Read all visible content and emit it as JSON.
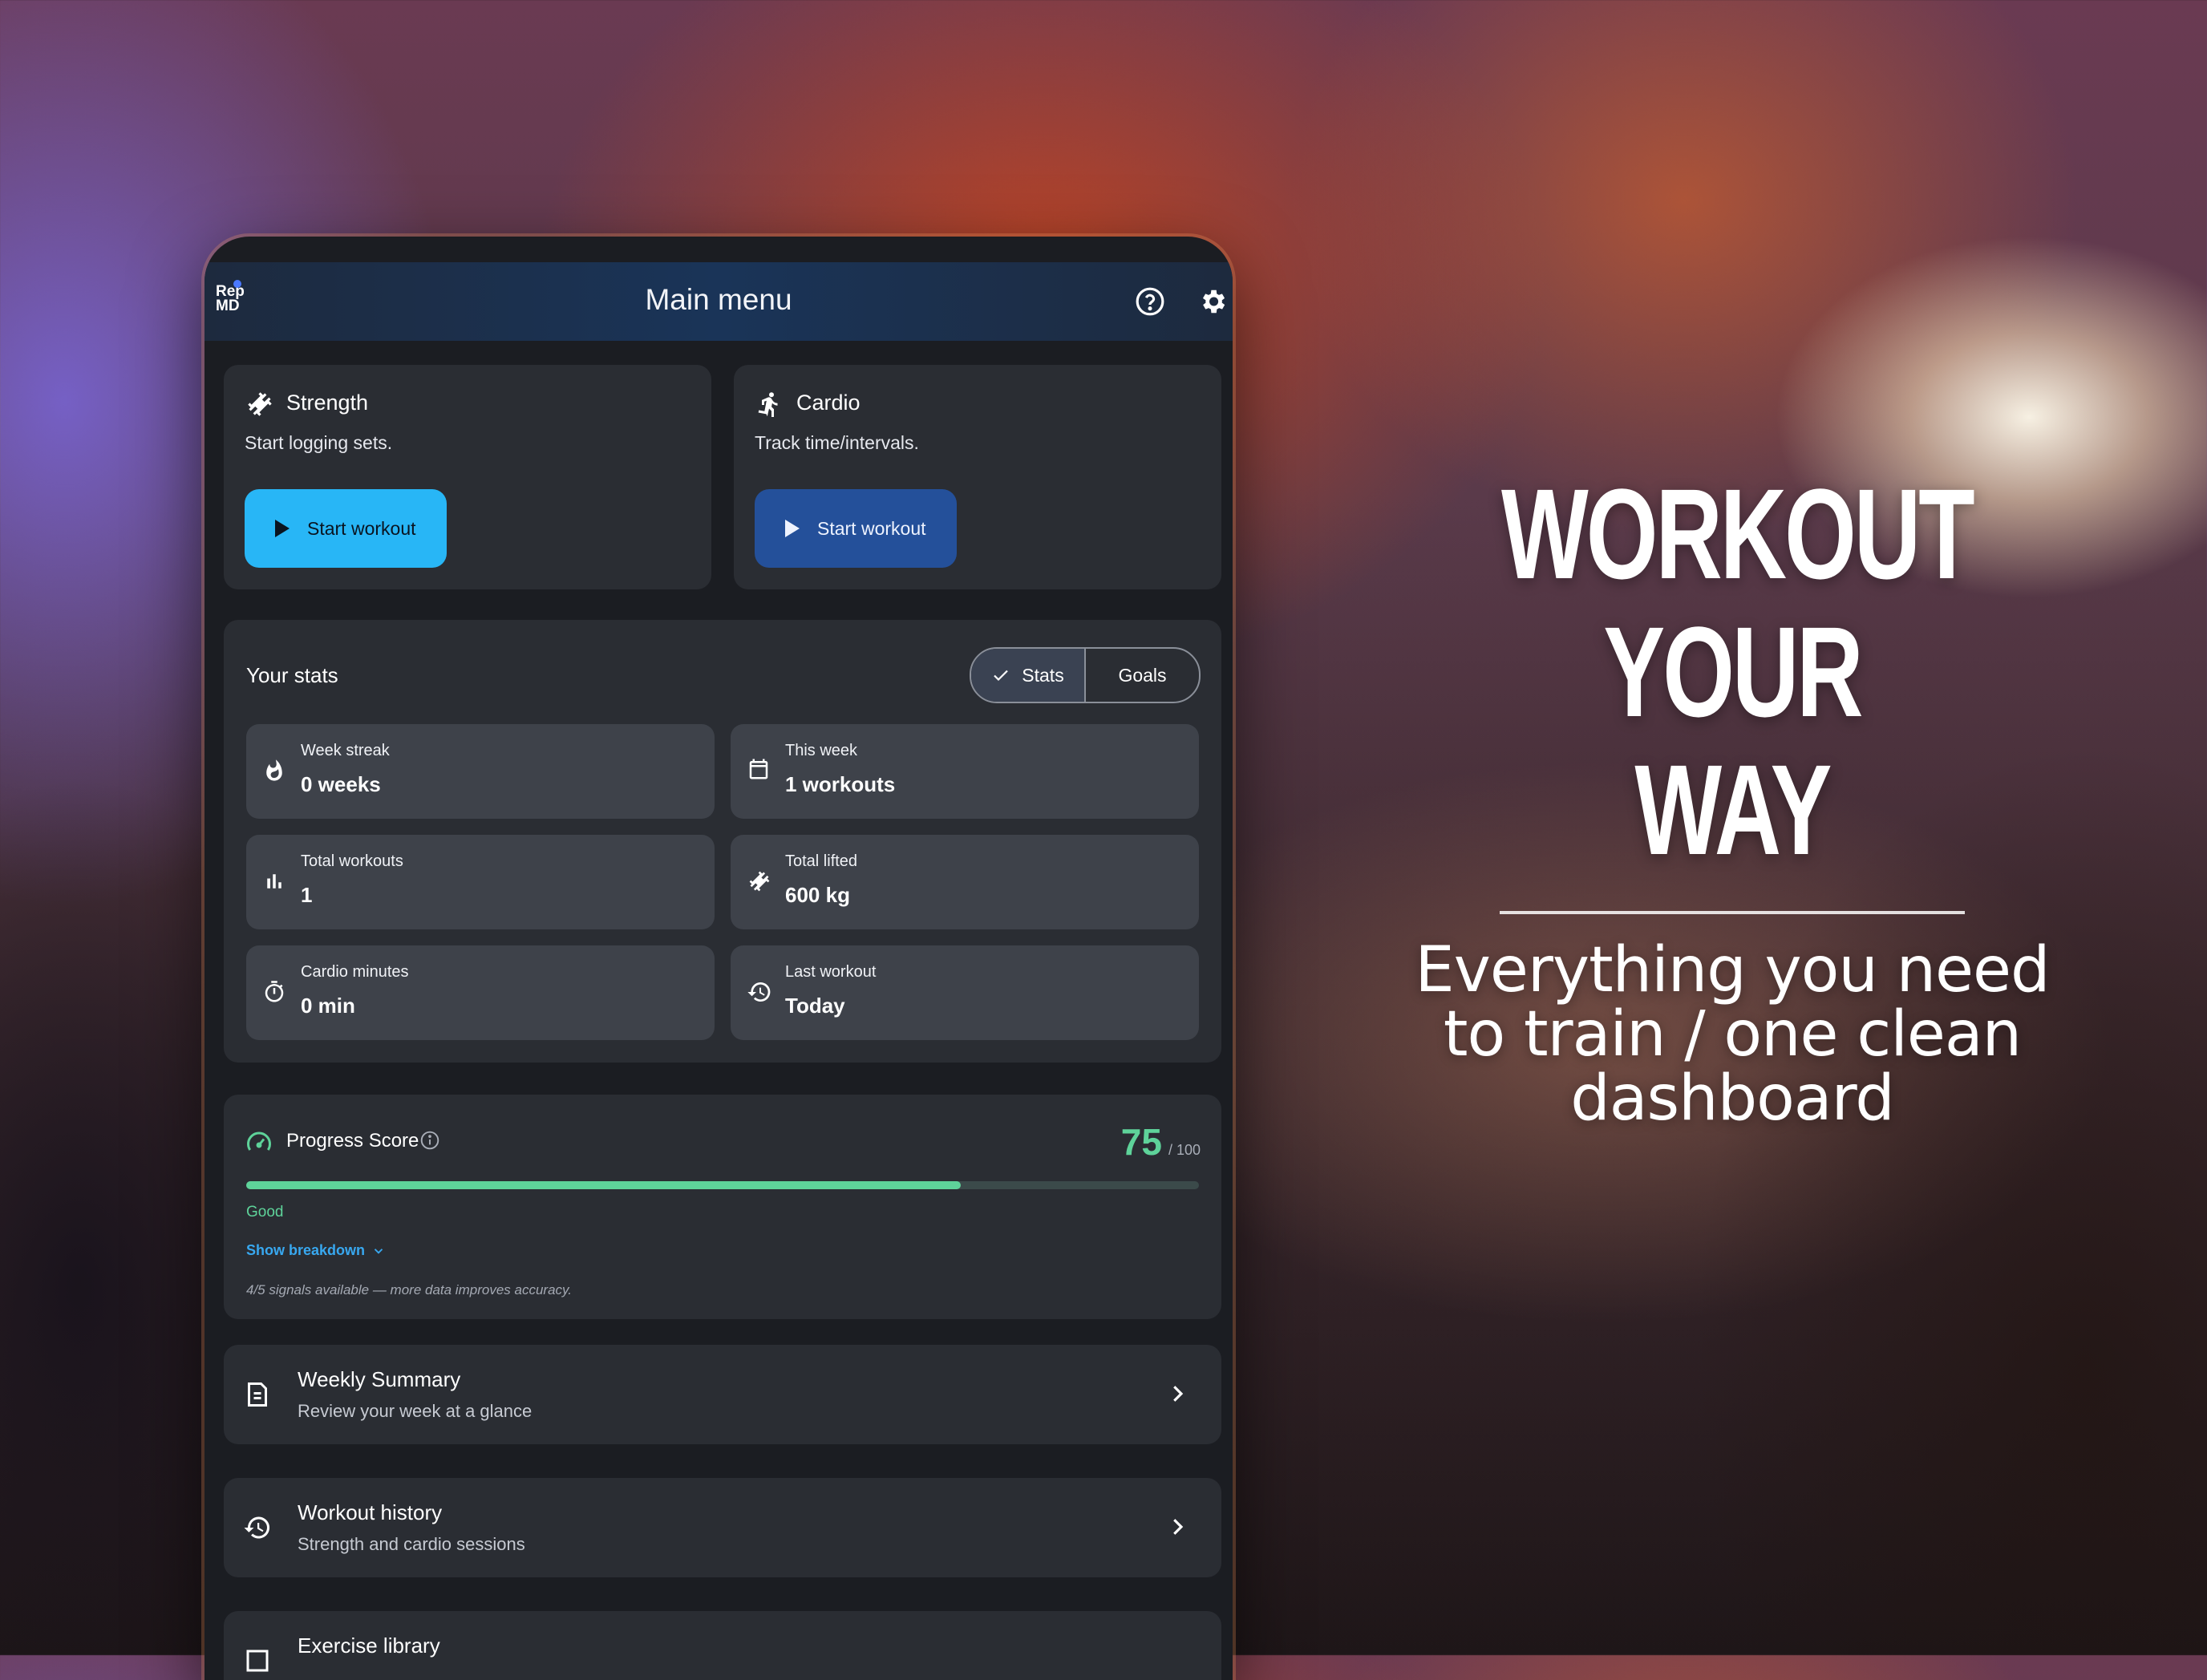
{
  "promo": {
    "title_line1": "WORKOUT",
    "title_line2": "YOUR WAY",
    "subtitle_line1": "Everything you need",
    "subtitle_line2": "to train / one clean",
    "subtitle_line3": "dashboard"
  },
  "app": {
    "logo_line1": "Rep",
    "logo_line2": "MD",
    "title": "Main menu",
    "help_icon": "help-circle-icon",
    "settings_icon": "gear-icon"
  },
  "strength": {
    "title": "Strength",
    "desc": "Start logging sets.",
    "button": "Start workout",
    "icon": "dumbbell-icon"
  },
  "cardio": {
    "title": "Cardio",
    "desc": "Track time/intervals.",
    "button": "Start workout",
    "icon": "running-icon"
  },
  "stats": {
    "title": "Your stats",
    "toggle": {
      "stats": "Stats",
      "goals": "Goals",
      "selected": "Stats"
    },
    "tiles": [
      {
        "label": "Week streak",
        "value": "0 weeks",
        "icon": "flame-icon"
      },
      {
        "label": "This week",
        "value": "1 workouts",
        "icon": "calendar-icon"
      },
      {
        "label": "Total workouts",
        "value": "1",
        "icon": "bar-chart-icon"
      },
      {
        "label": "Total lifted",
        "value": "600 kg",
        "icon": "dumbbell-icon"
      },
      {
        "label": "Cardio minutes",
        "value": "0 min",
        "icon": "timer-icon"
      },
      {
        "label": "Last workout",
        "value": "Today",
        "icon": "history-icon"
      }
    ]
  },
  "progress": {
    "title": "Progress Score",
    "score": "75",
    "max": "/ 100",
    "fraction": 0.75,
    "status": "Good",
    "breakdown_link": "Show breakdown",
    "note": "4/5 signals available — more data improves accuracy."
  },
  "menu_rows": [
    {
      "title": "Weekly Summary",
      "sub": "Review your week at a glance",
      "icon": "summary-doc-icon"
    },
    {
      "title": "Workout history",
      "sub": "Strength and cardio sessions",
      "icon": "history-icon"
    },
    {
      "title": "Exercise library",
      "sub": "",
      "icon": "library-icon"
    }
  ],
  "colors": {
    "accent_blue": "#28b6f6",
    "secondary_blue": "#24509a",
    "progress_green": "#5ed39a",
    "card_bg": "#2a2d33",
    "tile_bg": "#3e424a"
  }
}
